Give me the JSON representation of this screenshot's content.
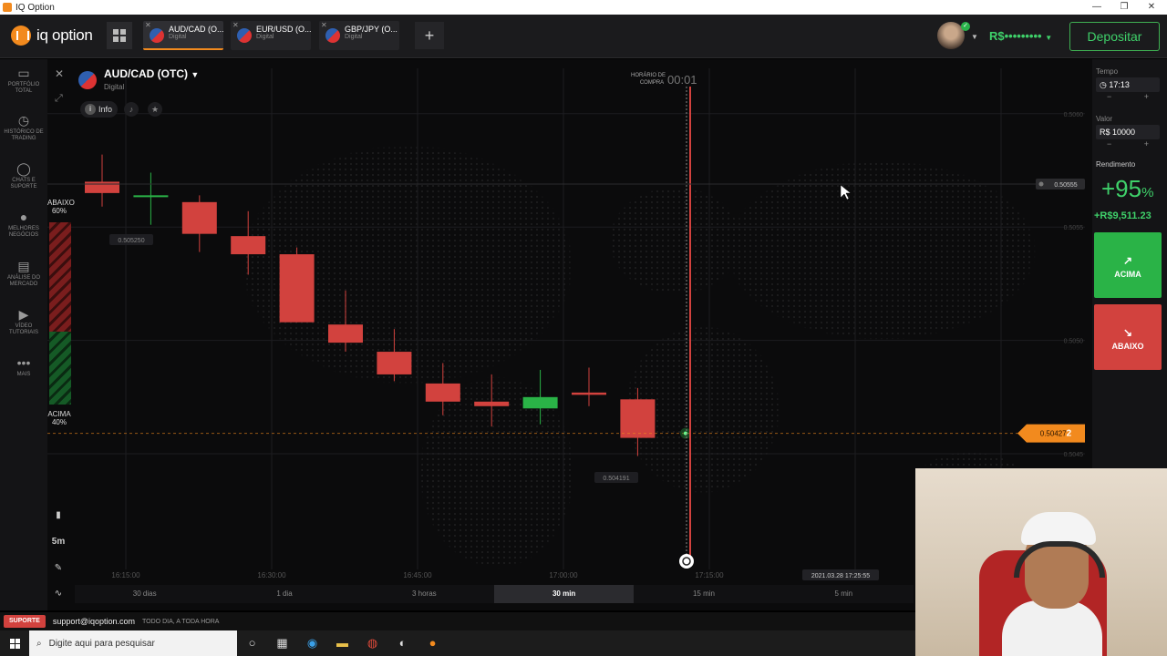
{
  "window": {
    "title": "IQ Option",
    "min": "—",
    "max": "❐",
    "close": "✕"
  },
  "header": {
    "logo_text": "iq option",
    "tabs": [
      {
        "name": "AUD/CAD (O...",
        "sub": "Digital"
      },
      {
        "name": "EUR/USD (O...",
        "sub": "Digital"
      },
      {
        "name": "GBP/JPY (O...",
        "sub": "Digital"
      }
    ],
    "add_label": "+",
    "balance": "R$•••••••••",
    "deposit_label": "Depositar",
    "verified_mark": "✓"
  },
  "sidebar": {
    "items": [
      {
        "label": "PORTFÓLIO TOTAL",
        "icon": "briefcase-icon",
        "glyph": "▭"
      },
      {
        "label": "HISTÓRICO DE TRADING",
        "icon": "history-icon",
        "glyph": "◷"
      },
      {
        "label": "CHATS E SUPORTE",
        "icon": "chat-icon",
        "glyph": "◯"
      },
      {
        "label": "MELHORES NEGÓCIOS",
        "icon": "podium-icon",
        "glyph": "●"
      },
      {
        "label": "ANÁLISE DO MERCADO",
        "icon": "news-icon",
        "glyph": "▤"
      },
      {
        "label": "VÍDEO TUTORIAIS",
        "icon": "play-icon",
        "glyph": "▶"
      },
      {
        "label": "MAIS",
        "icon": "more-icon",
        "glyph": "•••"
      }
    ]
  },
  "asset": {
    "name": "AUD/CAD (OTC)",
    "type": "Digital",
    "info_label": "Info"
  },
  "sentiment": {
    "down_label": "ABAIXO",
    "down_pct": "60%",
    "up_label": "ACIMA",
    "up_pct": "40%",
    "down_fraction": 0.6
  },
  "tools": {
    "timeframe": "5m"
  },
  "chart_data": {
    "type": "candlestick",
    "x_ticks": [
      "16:15:00",
      "16:30:00",
      "16:45:00",
      "17:00:00",
      "17:15:00"
    ],
    "y_ticks": [
      "0.5060",
      "0.5055",
      "0.5050",
      "0.5045"
    ],
    "ylim": [
      0.50405,
      0.50618
    ],
    "candles": [
      {
        "t": 0,
        "o": 0.5057,
        "c": 0.50565,
        "h": 0.50582,
        "l": 0.50559
      },
      {
        "t": 1,
        "o": 0.50564,
        "c": 0.50564,
        "h": 0.50574,
        "l": 0.50551
      },
      {
        "t": 2,
        "o": 0.50561,
        "c": 0.50547,
        "h": 0.50564,
        "l": 0.50539
      },
      {
        "t": 3,
        "o": 0.50546,
        "c": 0.50538,
        "h": 0.50557,
        "l": 0.50529
      },
      {
        "t": 4,
        "o": 0.50538,
        "c": 0.50508,
        "h": 0.50541,
        "l": 0.50508
      },
      {
        "t": 5,
        "o": 0.50507,
        "c": 0.50499,
        "h": 0.50522,
        "l": 0.50495
      },
      {
        "t": 6,
        "o": 0.50495,
        "c": 0.50485,
        "h": 0.50505,
        "l": 0.50482
      },
      {
        "t": 7,
        "o": 0.50481,
        "c": 0.50473,
        "h": 0.5049,
        "l": 0.50467
      },
      {
        "t": 8,
        "o": 0.50473,
        "c": 0.50471,
        "h": 0.50485,
        "l": 0.50462
      },
      {
        "t": 9,
        "o": 0.5047,
        "c": 0.50475,
        "h": 0.50487,
        "l": 0.50463
      },
      {
        "t": 10,
        "o": 0.50477,
        "c": 0.50476,
        "h": 0.50488,
        "l": 0.50471
      },
      {
        "t": 11,
        "o": 0.50474,
        "c": 0.50457,
        "h": 0.50479,
        "l": 0.50449
      }
    ],
    "up_color": "#2ab347",
    "down_color": "#d2423e",
    "current_price": "0.50427",
    "current_price_last": "2",
    "current_value": 0.50459,
    "label_high": "0.505250",
    "label_low": "0.504191",
    "alert_price": "0.50555",
    "purchase_time_label": "HORÁRIO DE COMPRA",
    "countdown": "00:01",
    "expiry_datetime": "2021.03.28 17:25:55",
    "grid": true
  },
  "timeframes": [
    "30 dias",
    "1 dia",
    "3 horas",
    "30 min",
    "15 min",
    "5 min"
  ],
  "timeframe_selected": "30 min",
  "trade": {
    "time_label": "Tempo",
    "time_value": "17:13",
    "amount_label": "Valor",
    "amount_value": "R$ 10000",
    "return_label": "Rendimento",
    "return_pct": "+95",
    "return_pct_sign": "%",
    "return_amount": "+R$9,511.23",
    "up_label": "ACIMA",
    "down_label": "ABAIXO",
    "minus": "−",
    "plus": "+"
  },
  "support": {
    "button": "SUPORTE",
    "email": "support@iqoption.com",
    "hours": "TODO DIA, A TODA HORA"
  },
  "taskbar": {
    "search_placeholder": "Digite aqui para pesquisar"
  },
  "colors": {
    "accent": "#f28a1e",
    "green": "#2ab347",
    "red": "#d2423e"
  }
}
